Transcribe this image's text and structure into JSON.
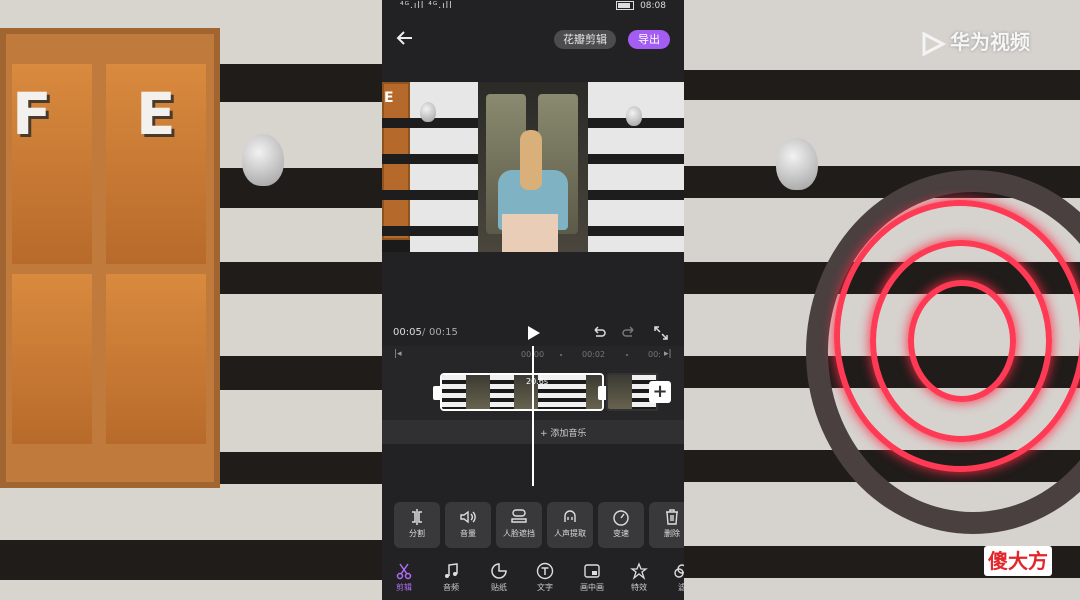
{
  "status_bar": {
    "signal": "⁴ᴳ.ıll ⁴ᴳ.ıll",
    "time": "08:08"
  },
  "header": {
    "back_icon": "arrow-left-icon",
    "brand_badge": "花瓣剪辑",
    "export_label": "导出"
  },
  "playback": {
    "current_time": "00:05",
    "separator": "/",
    "total_time": "00:15"
  },
  "ruler": {
    "ticks": [
      "00:00",
      "00:02",
      "00:"
    ]
  },
  "timeline": {
    "clip_duration": "20.6s",
    "add_music_label": "+ 添加音乐"
  },
  "tools": [
    {
      "icon": "split-icon",
      "label": "分割"
    },
    {
      "icon": "volume-icon",
      "label": "音量"
    },
    {
      "icon": "face-mask-icon",
      "label": "人脸遮挡"
    },
    {
      "icon": "voice-extract-icon",
      "label": "人声提取"
    },
    {
      "icon": "speed-icon",
      "label": "变速"
    },
    {
      "icon": "trash-icon",
      "label": "删除"
    }
  ],
  "bottom_nav": [
    {
      "icon": "scissors-icon",
      "label": "剪辑",
      "active": true
    },
    {
      "icon": "music-note-icon",
      "label": "音频"
    },
    {
      "icon": "sticker-icon",
      "label": "贴纸"
    },
    {
      "icon": "text-icon",
      "label": "文字"
    },
    {
      "icon": "picture-in-picture-icon",
      "label": "画中画"
    },
    {
      "icon": "effects-icon",
      "label": "特效"
    },
    {
      "icon": "filter-icon",
      "label": "滤"
    }
  ],
  "watermarks": {
    "top_right": "华为视频",
    "bottom_right": "傻大方"
  },
  "background": {
    "sign_letters": [
      "F",
      "E"
    ]
  },
  "colors": {
    "accent": "#a35df2",
    "neon": "#ff3a55",
    "app_bg": "#222224"
  }
}
